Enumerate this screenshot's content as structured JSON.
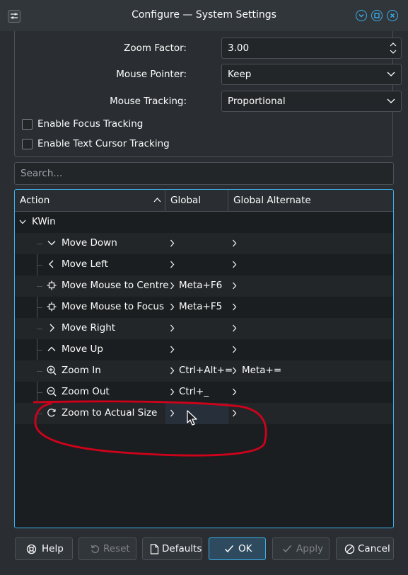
{
  "window": {
    "title": "Configure — System Settings",
    "icon": "settings-app-icon",
    "controls": [
      "minimize-icon",
      "maximize-icon",
      "close-icon"
    ],
    "accent_color": "#3daee9"
  },
  "settings": {
    "zoom_factor": {
      "label": "Zoom Factor:",
      "value": "3.00"
    },
    "mouse_pointer": {
      "label": "Mouse Pointer:",
      "value": "Keep"
    },
    "mouse_tracking": {
      "label": "Mouse Tracking:",
      "value": "Proportional"
    },
    "focus_tracking": {
      "label": "Enable Focus Tracking",
      "checked": false
    },
    "text_cursor_tracking": {
      "label": "Enable Text Cursor Tracking",
      "checked": false
    }
  },
  "search": {
    "placeholder": "Search..."
  },
  "table": {
    "columns": [
      "Action",
      "Global",
      "Global Alternate"
    ],
    "group": "KWin",
    "rows": [
      {
        "icon": "chevron-down-icon",
        "action": "Move Down",
        "global": "",
        "alternate": ""
      },
      {
        "icon": "chevron-left-icon",
        "action": "Move Left",
        "global": "",
        "alternate": ""
      },
      {
        "icon": "crosshair-icon",
        "action": "Move Mouse to Centre",
        "global": "Meta+F6",
        "alternate": ""
      },
      {
        "icon": "crosshair-icon",
        "action": "Move Mouse to Focus",
        "global": "Meta+F5",
        "alternate": ""
      },
      {
        "icon": "chevron-right-icon",
        "action": "Move Right",
        "global": "",
        "alternate": ""
      },
      {
        "icon": "chevron-up-icon",
        "action": "Move Up",
        "global": "",
        "alternate": ""
      },
      {
        "icon": "zoom-in-icon",
        "action": "Zoom In",
        "global": "Ctrl+Alt+=",
        "alternate": "Meta+="
      },
      {
        "icon": "zoom-out-icon",
        "action": "Zoom Out",
        "global": "Ctrl+_",
        "alternate": ""
      },
      {
        "icon": "zoom-original-icon",
        "action": "Zoom to Actual Size",
        "global": "",
        "alternate": ""
      }
    ]
  },
  "buttons": {
    "help": "Help",
    "reset": "Reset",
    "defaults": "Defaults",
    "ok": "OK",
    "apply": "Apply",
    "cancel": "Cancel"
  },
  "annotation_color": "#d0021b"
}
